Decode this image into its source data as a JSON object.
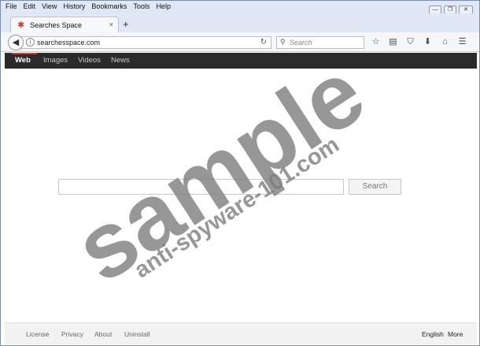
{
  "menu": [
    "File",
    "Edit",
    "View",
    "History",
    "Bookmarks",
    "Tools",
    "Help"
  ],
  "window_controls": {
    "minimize": "—",
    "restore": "❐",
    "close": "✕"
  },
  "tab": {
    "title": "Searches Space",
    "close": "×",
    "new_tab": "+"
  },
  "address": {
    "url": "searchesspace.com",
    "info": "i",
    "reload": "↻"
  },
  "search_bar": {
    "placeholder": "Search",
    "icon": "search-icon"
  },
  "toolbar_icons": [
    "star-icon",
    "reading-list-icon",
    "pocket-icon",
    "download-icon",
    "home-icon",
    "menu-icon"
  ],
  "site_nav": {
    "items": [
      "Web",
      "Images",
      "Videos",
      "News"
    ],
    "active": "Web",
    "accent": "#d33a2c"
  },
  "main": {
    "search_value": "",
    "search_button": "Search"
  },
  "footer": {
    "links": [
      "License",
      "Privacy",
      "About",
      "Uninstall"
    ],
    "language": "English",
    "more": "More"
  },
  "watermark": {
    "line1": "sample",
    "line2": "anti-spyware-101.com"
  }
}
